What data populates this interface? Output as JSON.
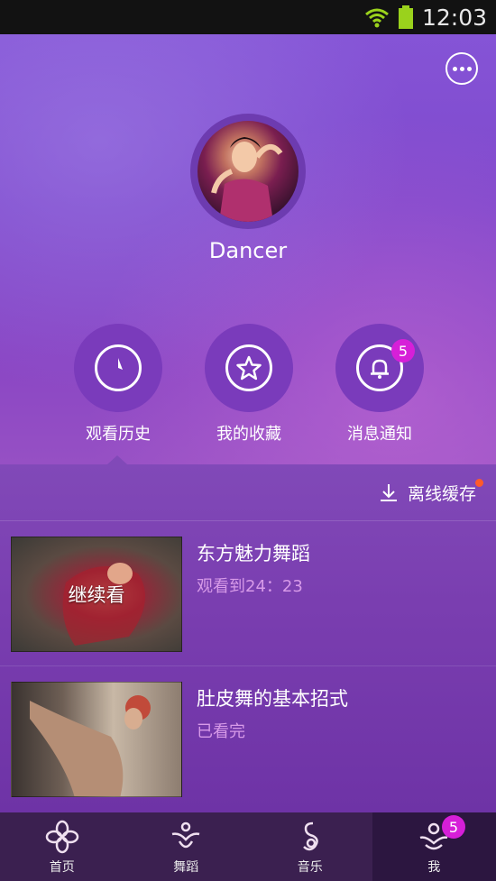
{
  "status_bar": {
    "time": "12:03"
  },
  "profile": {
    "username": "Dancer"
  },
  "quick_actions": [
    {
      "label": "观看历史",
      "icon": "clock-icon"
    },
    {
      "label": "我的收藏",
      "icon": "star-icon"
    },
    {
      "label": "消息通知",
      "icon": "bell-icon",
      "badge": "5"
    }
  ],
  "offline": {
    "label": "离线缓存",
    "icon": "download-icon"
  },
  "history": [
    {
      "title": "东方魅力舞蹈",
      "status": "观看到24：23",
      "overlay": "继续看"
    },
    {
      "title": "肚皮舞的基本招式",
      "status": "已看完",
      "overlay": ""
    }
  ],
  "tabs": [
    {
      "label": "首页",
      "icon": "home-flower-icon"
    },
    {
      "label": "舞蹈",
      "icon": "dance-icon"
    },
    {
      "label": "音乐",
      "icon": "music-icon"
    },
    {
      "label": "我",
      "icon": "me-icon",
      "badge": "5"
    }
  ],
  "colors": {
    "accent": "#d61fd8",
    "hero_top": "#8554d6",
    "tabbar": "#3b2050",
    "subtitle": "#d79ae8"
  }
}
